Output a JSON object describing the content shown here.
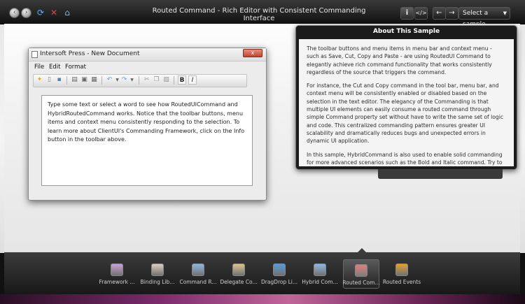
{
  "app": {
    "title": "Routed Command - Rich Editor with Consistent Commanding Interface",
    "select_sample_label": "Select a sample"
  },
  "topbar": {
    "info_glyph": "i",
    "code_glyph": "</>",
    "back_glyph": "←",
    "forward_glyph": "→"
  },
  "editor": {
    "window_title": "Intersoft Press - New Document",
    "close_glyph": "x",
    "menu": [
      "File",
      "Edit",
      "Format"
    ],
    "bold_label": "B",
    "italic_label": "I",
    "content": "Type some text or select a word to see how RoutedUICommand and HybridRoutedCommand works. Notice that the toolbar buttons, menu items and context menu consistently responding to the selection. To learn more about ClientUI's Commanding Framework, click on the Info button in the toolbar above."
  },
  "about": {
    "title": "About This Sample",
    "paragraphs": [
      "The toolbar buttons and menu items in menu bar and context menu - such as Save, Cut, Copy and Paste - are using RoutedUI Command to elegantly achieve rich command functionality that works consistently regardless of the source that triggers the command.",
      "For instance, the Cut and Copy command in the tool bar, menu bar, and context menu will be consistently enabled or disabled based on the selection in the text editor. The elegancy of the Commanding is that multiple UI elements can easily consume a routed command through simple Command property set without have to write the same set of logic and code. This centralized commanding pattern ensures greater UI scalability and dramatically reduces bugs and unexpected errors in dynamic UI application.",
      "In this sample, HybridCommand is also used to enable solid commanding for more advanced scenarios such as the Bold and Italic command. Try to select a"
    ]
  },
  "dock": {
    "items": [
      {
        "label": "Framework ...",
        "icon": "framework-icon",
        "color": "#c7a0d8"
      },
      {
        "label": "Binding Lib...",
        "icon": "binding-library-icon",
        "color": "#d8d0c0"
      },
      {
        "label": "Command R...",
        "icon": "command-reference-icon",
        "color": "#8fb6dc"
      },
      {
        "label": "Delegate Co...",
        "icon": "delegate-command-icon",
        "color": "#d9c38e"
      },
      {
        "label": "DragDrop Li...",
        "icon": "dragdrop-library-icon",
        "color": "#5a9ad6"
      },
      {
        "label": "Hybrid Com...",
        "icon": "hybrid-command-icon",
        "color": "#8fb6dc"
      },
      {
        "label": "Routed Com...",
        "icon": "routed-command-icon",
        "color": "#e07a7a"
      },
      {
        "label": "Routed Events",
        "icon": "routed-events-icon",
        "color": "#e0a030"
      }
    ],
    "selected_index": 6
  }
}
